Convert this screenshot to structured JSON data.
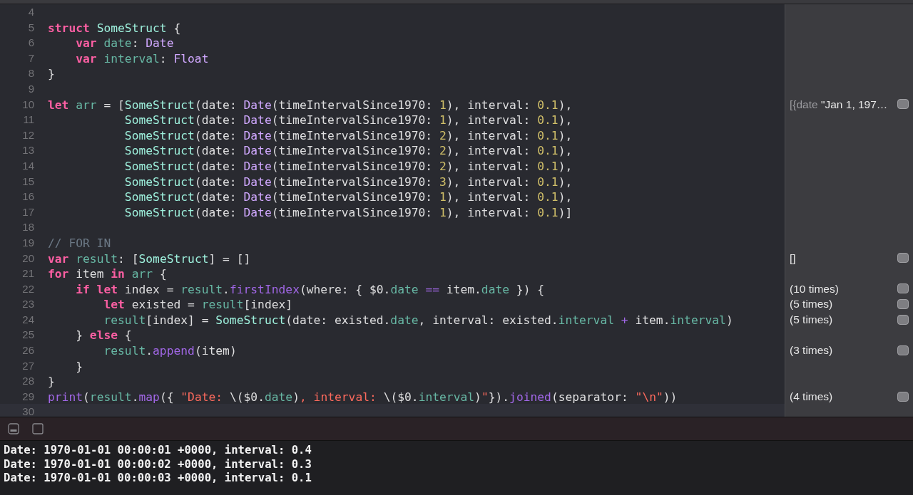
{
  "editor": {
    "lines": [
      {
        "number": "4"
      },
      {
        "number": "5",
        "tokens": [
          {
            "kind": "kw",
            "text": "struct "
          },
          {
            "kind": "type",
            "text": "SomeStruct"
          },
          {
            "kind": "plain",
            "text": " {"
          }
        ]
      },
      {
        "number": "6",
        "tokens": [
          {
            "kind": "kw",
            "text": "    var "
          },
          {
            "kind": "proj",
            "text": "date"
          },
          {
            "kind": "plain",
            "text": ": "
          },
          {
            "kind": "systype",
            "text": "Date"
          }
        ]
      },
      {
        "number": "7",
        "tokens": [
          {
            "kind": "kw",
            "text": "    var "
          },
          {
            "kind": "proj",
            "text": "interval"
          },
          {
            "kind": "plain",
            "text": ": "
          },
          {
            "kind": "systype",
            "text": "Float"
          }
        ]
      },
      {
        "number": "8",
        "tokens": [
          {
            "kind": "plain",
            "text": "}"
          }
        ]
      },
      {
        "number": "9"
      },
      {
        "number": "10",
        "tokens": [
          {
            "kind": "kw",
            "text": "let "
          },
          {
            "kind": "proj",
            "text": "arr"
          },
          {
            "kind": "plain",
            "text": " = ["
          },
          {
            "kind": "type",
            "text": "SomeStruct"
          },
          {
            "kind": "plain",
            "text": "(date: "
          },
          {
            "kind": "systype",
            "text": "Date"
          },
          {
            "kind": "plain",
            "text": "(timeIntervalSince1970: "
          },
          {
            "kind": "num",
            "text": "1"
          },
          {
            "kind": "plain",
            "text": "), interval: "
          },
          {
            "kind": "num",
            "text": "0.1"
          },
          {
            "kind": "plain",
            "text": "),"
          }
        ],
        "result": {
          "parts": [
            {
              "kind": "label",
              "text": "[{date"
            },
            {
              "kind": "value",
              "text": "\"Jan 1, 197…"
            }
          ]
        }
      },
      {
        "number": "11",
        "tokens": [
          {
            "kind": "type",
            "text": "           SomeStruct"
          },
          {
            "kind": "plain",
            "text": "(date: "
          },
          {
            "kind": "systype",
            "text": "Date"
          },
          {
            "kind": "plain",
            "text": "(timeIntervalSince1970: "
          },
          {
            "kind": "num",
            "text": "1"
          },
          {
            "kind": "plain",
            "text": "), interval: "
          },
          {
            "kind": "num",
            "text": "0.1"
          },
          {
            "kind": "plain",
            "text": "),"
          }
        ]
      },
      {
        "number": "12",
        "tokens": [
          {
            "kind": "type",
            "text": "           SomeStruct"
          },
          {
            "kind": "plain",
            "text": "(date: "
          },
          {
            "kind": "systype",
            "text": "Date"
          },
          {
            "kind": "plain",
            "text": "(timeIntervalSince1970: "
          },
          {
            "kind": "num",
            "text": "2"
          },
          {
            "kind": "plain",
            "text": "), interval: "
          },
          {
            "kind": "num",
            "text": "0.1"
          },
          {
            "kind": "plain",
            "text": "),"
          }
        ]
      },
      {
        "number": "13",
        "tokens": [
          {
            "kind": "type",
            "text": "           SomeStruct"
          },
          {
            "kind": "plain",
            "text": "(date: "
          },
          {
            "kind": "systype",
            "text": "Date"
          },
          {
            "kind": "plain",
            "text": "(timeIntervalSince1970: "
          },
          {
            "kind": "num",
            "text": "2"
          },
          {
            "kind": "plain",
            "text": "), interval: "
          },
          {
            "kind": "num",
            "text": "0.1"
          },
          {
            "kind": "plain",
            "text": "),"
          }
        ]
      },
      {
        "number": "14",
        "tokens": [
          {
            "kind": "type",
            "text": "           SomeStruct"
          },
          {
            "kind": "plain",
            "text": "(date: "
          },
          {
            "kind": "systype",
            "text": "Date"
          },
          {
            "kind": "plain",
            "text": "(timeIntervalSince1970: "
          },
          {
            "kind": "num",
            "text": "2"
          },
          {
            "kind": "plain",
            "text": "), interval: "
          },
          {
            "kind": "num",
            "text": "0.1"
          },
          {
            "kind": "plain",
            "text": "),"
          }
        ]
      },
      {
        "number": "15",
        "tokens": [
          {
            "kind": "type",
            "text": "           SomeStruct"
          },
          {
            "kind": "plain",
            "text": "(date: "
          },
          {
            "kind": "systype",
            "text": "Date"
          },
          {
            "kind": "plain",
            "text": "(timeIntervalSince1970: "
          },
          {
            "kind": "num",
            "text": "3"
          },
          {
            "kind": "plain",
            "text": "), interval: "
          },
          {
            "kind": "num",
            "text": "0.1"
          },
          {
            "kind": "plain",
            "text": "),"
          }
        ]
      },
      {
        "number": "16",
        "tokens": [
          {
            "kind": "type",
            "text": "           SomeStruct"
          },
          {
            "kind": "plain",
            "text": "(date: "
          },
          {
            "kind": "systype",
            "text": "Date"
          },
          {
            "kind": "plain",
            "text": "(timeIntervalSince1970: "
          },
          {
            "kind": "num",
            "text": "1"
          },
          {
            "kind": "plain",
            "text": "), interval: "
          },
          {
            "kind": "num",
            "text": "0.1"
          },
          {
            "kind": "plain",
            "text": "),"
          }
        ]
      },
      {
        "number": "17",
        "tokens": [
          {
            "kind": "type",
            "text": "           SomeStruct"
          },
          {
            "kind": "plain",
            "text": "(date: "
          },
          {
            "kind": "systype",
            "text": "Date"
          },
          {
            "kind": "plain",
            "text": "(timeIntervalSince1970: "
          },
          {
            "kind": "num",
            "text": "1"
          },
          {
            "kind": "plain",
            "text": "), interval: "
          },
          {
            "kind": "num",
            "text": "0.1"
          },
          {
            "kind": "plain",
            "text": ")]"
          }
        ]
      },
      {
        "number": "18"
      },
      {
        "number": "19",
        "tokens": [
          {
            "kind": "cmt",
            "text": "// FOR IN"
          }
        ]
      },
      {
        "number": "20",
        "tokens": [
          {
            "kind": "kw",
            "text": "var "
          },
          {
            "kind": "proj",
            "text": "result"
          },
          {
            "kind": "plain",
            "text": ": ["
          },
          {
            "kind": "type",
            "text": "SomeStruct"
          },
          {
            "kind": "plain",
            "text": "] = []"
          }
        ],
        "result": {
          "parts": [
            {
              "kind": "value",
              "text": "[]"
            }
          ]
        }
      },
      {
        "number": "21",
        "tokens": [
          {
            "kind": "kw",
            "text": "for"
          },
          {
            "kind": "plain",
            "text": " item "
          },
          {
            "kind": "kw",
            "text": "in "
          },
          {
            "kind": "proj",
            "text": "arr"
          },
          {
            "kind": "plain",
            "text": " {"
          }
        ]
      },
      {
        "number": "22",
        "tokens": [
          {
            "kind": "kw",
            "text": "    if let"
          },
          {
            "kind": "plain",
            "text": " index = "
          },
          {
            "kind": "proj",
            "text": "result"
          },
          {
            "kind": "plain",
            "text": "."
          },
          {
            "kind": "sysfn",
            "text": "firstIndex"
          },
          {
            "kind": "plain",
            "text": "(where: { $0."
          },
          {
            "kind": "proj",
            "text": "date"
          },
          {
            "kind": "sysfn",
            "text": " == "
          },
          {
            "kind": "plain",
            "text": "item."
          },
          {
            "kind": "proj",
            "text": "date"
          },
          {
            "kind": "plain",
            "text": " }) {"
          }
        ],
        "result": {
          "parts": [
            {
              "kind": "value",
              "text": "(10 times)"
            }
          ]
        }
      },
      {
        "number": "23",
        "tokens": [
          {
            "kind": "kw",
            "text": "        let"
          },
          {
            "kind": "plain",
            "text": " existed = "
          },
          {
            "kind": "proj",
            "text": "result"
          },
          {
            "kind": "plain",
            "text": "[index]"
          }
        ],
        "result": {
          "parts": [
            {
              "kind": "value",
              "text": "(5 times)"
            }
          ]
        }
      },
      {
        "number": "24",
        "tokens": [
          {
            "kind": "proj",
            "text": "        result"
          },
          {
            "kind": "plain",
            "text": "[index] = "
          },
          {
            "kind": "type",
            "text": "SomeStruct"
          },
          {
            "kind": "plain",
            "text": "(date: existed."
          },
          {
            "kind": "proj",
            "text": "date"
          },
          {
            "kind": "plain",
            "text": ", interval: existed."
          },
          {
            "kind": "proj",
            "text": "interval"
          },
          {
            "kind": "sysfn",
            "text": " + "
          },
          {
            "kind": "plain",
            "text": "item."
          },
          {
            "kind": "proj",
            "text": "interval"
          },
          {
            "kind": "plain",
            "text": ")"
          }
        ],
        "result": {
          "parts": [
            {
              "kind": "value",
              "text": "(5 times)"
            }
          ]
        }
      },
      {
        "number": "25",
        "tokens": [
          {
            "kind": "plain",
            "text": "    } "
          },
          {
            "kind": "kw",
            "text": "else"
          },
          {
            "kind": "plain",
            "text": " {"
          }
        ]
      },
      {
        "number": "26",
        "tokens": [
          {
            "kind": "proj",
            "text": "        result"
          },
          {
            "kind": "plain",
            "text": "."
          },
          {
            "kind": "sysfn",
            "text": "append"
          },
          {
            "kind": "plain",
            "text": "(item)"
          }
        ],
        "result": {
          "parts": [
            {
              "kind": "value",
              "text": "(3 times)"
            }
          ]
        }
      },
      {
        "number": "27",
        "tokens": [
          {
            "kind": "plain",
            "text": "    }"
          }
        ]
      },
      {
        "number": "28",
        "tokens": [
          {
            "kind": "plain",
            "text": "}"
          }
        ]
      },
      {
        "number": "29",
        "tokens": [
          {
            "kind": "sysfn",
            "text": "print"
          },
          {
            "kind": "plain",
            "text": "("
          },
          {
            "kind": "proj",
            "text": "result"
          },
          {
            "kind": "plain",
            "text": "."
          },
          {
            "kind": "sysfn",
            "text": "map"
          },
          {
            "kind": "plain",
            "text": "({ "
          },
          {
            "kind": "str",
            "text": "\"Date: "
          },
          {
            "kind": "plain",
            "text": "\\($0."
          },
          {
            "kind": "proj",
            "text": "date"
          },
          {
            "kind": "plain",
            "text": ")"
          },
          {
            "kind": "str",
            "text": ", interval: "
          },
          {
            "kind": "plain",
            "text": "\\($0."
          },
          {
            "kind": "proj",
            "text": "interval"
          },
          {
            "kind": "plain",
            "text": ")"
          },
          {
            "kind": "str",
            "text": "\""
          },
          {
            "kind": "plain",
            "text": "})."
          },
          {
            "kind": "sysfn",
            "text": "joined"
          },
          {
            "kind": "plain",
            "text": "(separator: "
          },
          {
            "kind": "str",
            "text": "\"\\n\""
          },
          {
            "kind": "plain",
            "text": "))"
          }
        ],
        "result": {
          "parts": [
            {
              "kind": "value",
              "text": "(4 times)"
            }
          ]
        }
      },
      {
        "number": "30",
        "current": true
      }
    ]
  },
  "console": {
    "lines": [
      "Date: 1970-01-01 00:00:01 +0000, interval: 0.4",
      "Date: 1970-01-01 00:00:02 +0000, interval: 0.3",
      "Date: 1970-01-01 00:00:03 +0000, interval: 0.1"
    ]
  }
}
